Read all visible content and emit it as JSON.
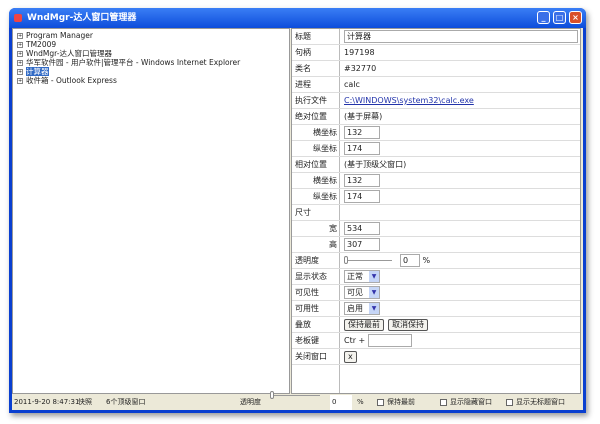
{
  "window": {
    "title": "WndMgr-达人窗口管理器"
  },
  "tree": [
    "Program Manager",
    "TM2009",
    "WndMgr-达人窗口管理器",
    "华军软件园 - 用户软件|管理平台 - Windows Internet Explorer",
    "计算器",
    "收件箱 - Outlook Express"
  ],
  "props": {
    "title_label": "标题",
    "title_value": "计算器",
    "handle_label": "句柄",
    "handle_value": "197198",
    "class_label": "类名",
    "class_value": "#32770",
    "process_label": "进程",
    "process_value": "calc",
    "exe_label": "执行文件",
    "exe_value": "C:\\WINDOWS\\system32\\calc.exe",
    "abs_label": "绝对位置",
    "abs_note": "(基于屏幕)",
    "x_label": "横坐标",
    "y_label": "纵坐标",
    "abs_x": "132",
    "abs_y": "174",
    "rel_label": "相对位置",
    "rel_note": "(基于顶级父窗口)",
    "rel_x": "132",
    "rel_y": "174",
    "size_label": "尺寸",
    "w_label": "宽",
    "h_label": "高",
    "w": "534",
    "h": "307",
    "opacity_label": "透明度",
    "opacity_value": "0",
    "pct": "%",
    "show_label": "显示状态",
    "show_value": "正常",
    "visible_label": "可见性",
    "visible_value": "可见",
    "enabled_label": "可用性",
    "enabled_value": "启用",
    "zorder_label": "叠放",
    "keep_top": "保持最前",
    "cancel_keep": "取消保持",
    "boss_label": "老板键",
    "boss_prefix": "Ctr +",
    "boss_value": "",
    "close_label": "关闭窗口",
    "close_btn": "x"
  },
  "status": {
    "time": "2011-9-20 8:47:31",
    "snapshot": "快照",
    "count": "6个顶级窗口",
    "opacity_label": "透明度",
    "opacity_value": "0",
    "pct": "%",
    "keep_top": "保持最前",
    "show_hidden": "显示隐藏窗口",
    "show_untitled": "显示无标题窗口"
  }
}
